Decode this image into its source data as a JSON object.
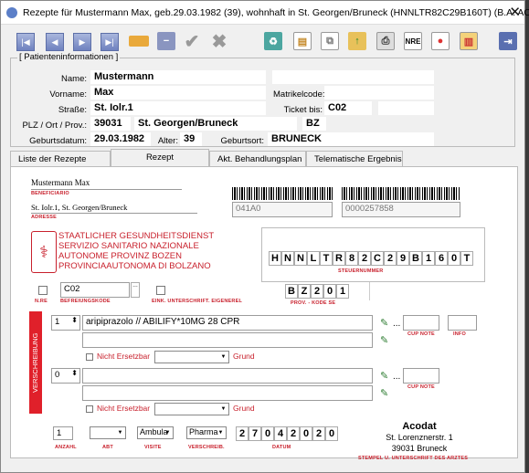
{
  "window": {
    "title": "Rezepte für Mustermann Max, geb.29.03.1982 (39), wohnhaft in St. Georgen/Bruneck (HNNLTR82C29B160T) (B.A. ACO)",
    "close": "✕"
  },
  "toolbar": {
    "icons": [
      "first-icon",
      "prev-icon",
      "next-icon",
      "last-icon",
      "edit-icon",
      "minus-icon",
      "check-icon",
      "cancel-icon",
      "recycle-icon",
      "document-icon",
      "copy-icon",
      "export-icon",
      "print-icon",
      "nre-icon",
      "stamp-icon",
      "note-icon",
      "exit-icon"
    ],
    "nre_label": "NRE"
  },
  "patient": {
    "legend": "[ Patienteninformationen ]",
    "name_label": "Name:",
    "name": "Mustermann",
    "vorname_label": "Vorname:",
    "vorname": "Max",
    "strasse_label": "Straße:",
    "strasse": "St. Iolr.1",
    "plz_label": "PLZ / Ort / Prov.:",
    "plz": "39031",
    "ort": "St. Georgen/Bruneck",
    "prov": "BZ",
    "geb_label": "Geburtsdatum:",
    "geb": "29.03.1982",
    "alter_label": "Alter:",
    "alter": "39",
    "geburtsort_label": "Geburtsort:",
    "geburtsort": "BRUNECK",
    "matrikel_label": "Matrikelcode:",
    "ticket_label": "Ticket bis:",
    "ticket": "C02"
  },
  "tabs": [
    "Liste der Rezepte",
    "Rezept",
    "Akt. Behandlungsplan",
    "Telematische Ergebnis"
  ],
  "rezept": {
    "patient_name": "Mustermann  Max",
    "beneficiary_label": "BENEFICIARIO",
    "address": "St. Iolr.1, St. Georgen/Bruneck",
    "address_label": "ADRESSE",
    "barcode1_num": "041A0",
    "barcode2_num": "0000257858",
    "agency": [
      "STAATLICHER GESUNDHEITSDIENST",
      "SERVIZIO SANITARIO NAZIONALE",
      "AUTONOME PROVINZ BOZEN",
      "PROVINCIAAUTONOMA DI BOLZANO"
    ],
    "steuer_chars": [
      "H",
      "N",
      "N",
      "L",
      "T",
      "R",
      "8",
      "2",
      "C",
      "2",
      "9",
      "B",
      "1",
      "6",
      "0",
      "T"
    ],
    "steuer_label": "STEUERNUMMER",
    "nre_label": "N.RE",
    "befreiungs_code": "C02",
    "befreiungs_label": "BEFREIUNGSKODE",
    "einschr_label": "EINK. UNTERSCHRIFT. EIGENEREL",
    "prov_chars": [
      "B",
      "Z",
      "2",
      "0",
      "1"
    ],
    "prov_label": "PROV. - KODE SE",
    "side_label": "VERSCHREIBUNG",
    "qty1": "1",
    "drug1": "aripiprazolo // ABILIFY*10MG 28 CPR",
    "qty2": "0",
    "nicht_ersetzbar": "Nicht Ersetzbar",
    "grund": "Grund",
    "cupnote": "CUP NOTE",
    "info": "INFO",
    "ellipsis": "...",
    "anzahl": "1",
    "anzahl_label": "ANZAHL",
    "abt_label": "ABT",
    "visite": "Ambula",
    "visite_label": "VISITE",
    "verschreib": "Pharma",
    "verschreib_label": "VERSCHREIB.",
    "datum_chars": [
      "2",
      "7",
      "0",
      "4",
      "2",
      "0",
      "2",
      "0"
    ],
    "datum_label": "DATUM",
    "doctor_name": "Acodat",
    "doctor_street": "St. Lorenznerstr. 1",
    "doctor_city": "39031 Bruneck",
    "stempel_label": "STEMPEL U. UNTERSCHRIFT DES ARZTES"
  },
  "colors": {
    "accent": "#c8202c",
    "rxbar": "#e0202a"
  }
}
